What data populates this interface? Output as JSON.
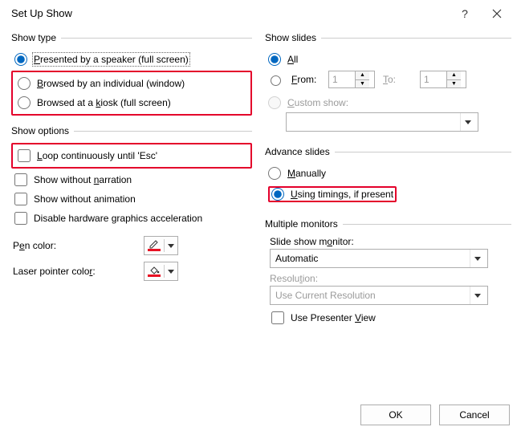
{
  "window": {
    "title": "Set Up Show",
    "help": "?",
    "close": "×"
  },
  "show_type": {
    "legend": "Show type",
    "opt1_pre": "",
    "opt1_u": "P",
    "opt1_post": "resented by a speaker (full screen)",
    "opt2_pre": "",
    "opt2_u": "B",
    "opt2_post": "rowsed by an individual (window)",
    "opt3_pre": "Browsed at a ",
    "opt3_u": "k",
    "opt3_post": "iosk (full screen)"
  },
  "show_options": {
    "legend": "Show options",
    "loop_pre": "",
    "loop_u": "L",
    "loop_post": "oop continuously until 'Esc'",
    "narr_pre": "Show without ",
    "narr_u": "n",
    "narr_post": "arration",
    "anim": "Show without animation",
    "hw_pre": "Disable hardware ",
    "hw_u": "g",
    "hw_post": "raphics acceleration",
    "pen_pre": "P",
    "pen_u": "e",
    "pen_post": "n color:",
    "laser_pre": "Laser pointer colo",
    "laser_u": "r",
    "laser_post": ":"
  },
  "show_slides": {
    "legend": "Show slides",
    "all_u": "A",
    "all_post": "ll",
    "from_u": "F",
    "from_post": "rom:",
    "from_val": "1",
    "to_u": "T",
    "to_post": "o:",
    "to_val": "1",
    "custom_u": "C",
    "custom_post": "ustom show:",
    "custom_val": ""
  },
  "advance": {
    "legend": "Advance slides",
    "manual_u": "M",
    "manual_post": "anually",
    "timings_u": "U",
    "timings_post": "sing timings, if present"
  },
  "monitors": {
    "legend": "Multiple monitors",
    "mon_label_pre": "Slide show m",
    "mon_label_u": "o",
    "mon_label_post": "nitor:",
    "mon_val": "Automatic",
    "res_label_pre": "Resolu",
    "res_label_u": "t",
    "res_label_post": "ion:",
    "res_val": "Use Current Resolution",
    "presenter_pre": "Use Presenter ",
    "presenter_u": "V",
    "presenter_post": "iew"
  },
  "buttons": {
    "ok": "OK",
    "cancel": "Cancel"
  }
}
